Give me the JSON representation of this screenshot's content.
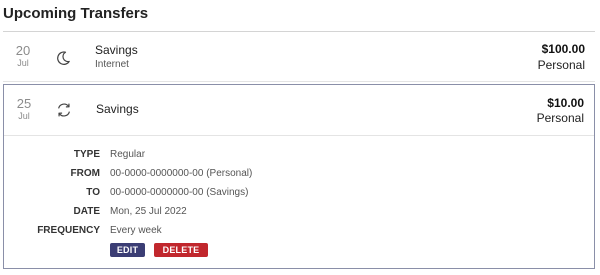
{
  "page": {
    "title": "Upcoming Transfers"
  },
  "transfers": [
    {
      "day": "20",
      "month": "Jul",
      "icon": "moon-icon",
      "name": "Savings",
      "subtitle": "Internet",
      "amount": "$100.00",
      "account": "Personal"
    },
    {
      "day": "25",
      "month": "Jul",
      "icon": "recurring-icon",
      "name": "Savings",
      "amount": "$10.00",
      "account": "Personal",
      "details": {
        "type_label": "TYPE",
        "type_value": "Regular",
        "from_label": "FROM",
        "from_value": "00-0000-0000000-00 (Personal)",
        "to_label": "TO",
        "to_value": "00-0000-0000000-00 (Savings)",
        "date_label": "DATE",
        "date_value": "Mon, 25 Jul 2022",
        "frequency_label": "FREQUENCY",
        "frequency_value": "Every week"
      },
      "actions": {
        "edit_label": "EDIT",
        "delete_label": "DELETE"
      }
    }
  ],
  "colors": {
    "edit_button": "#3b3d74",
    "delete_button": "#c1272d",
    "expanded_border": "#8a8fa8",
    "muted_text": "#8c8c8c"
  }
}
